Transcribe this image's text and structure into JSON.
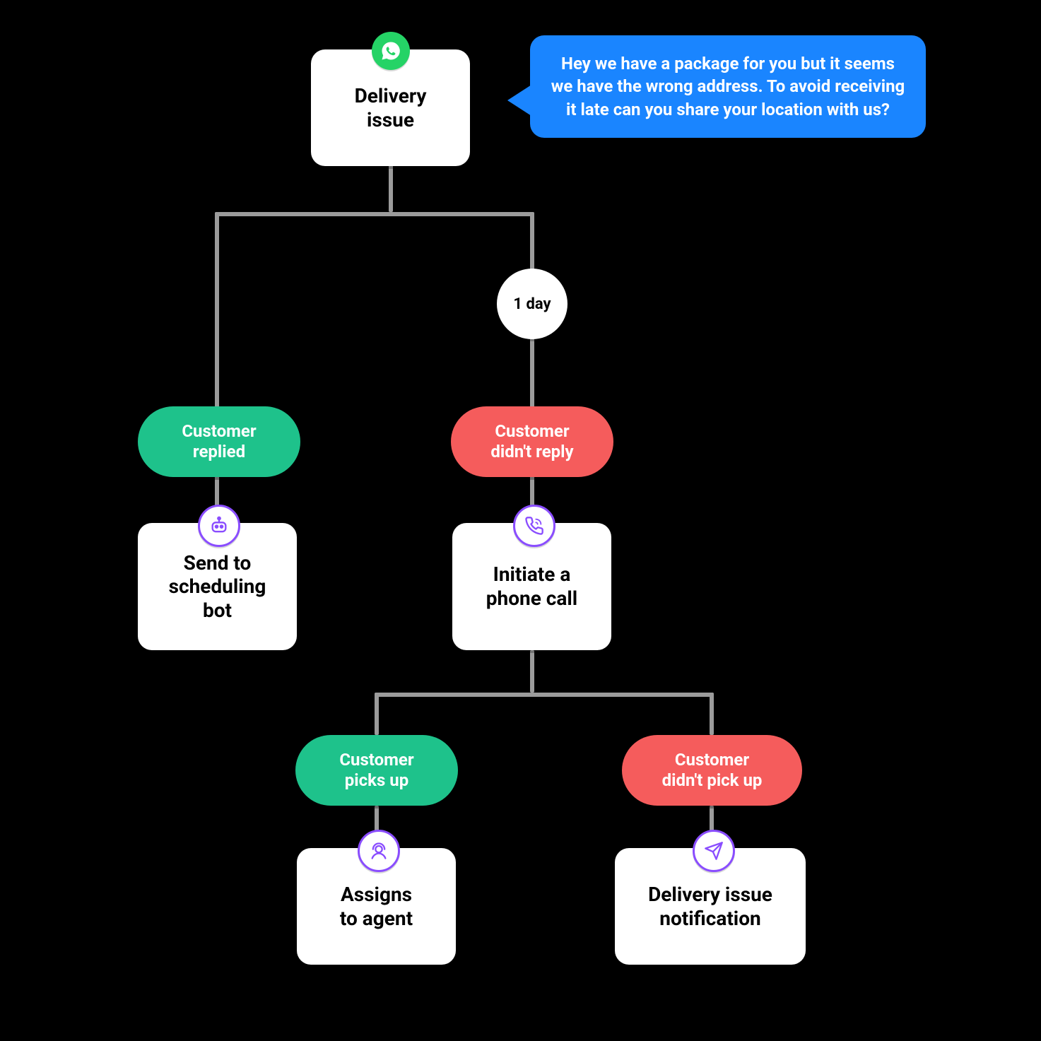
{
  "root_card": {
    "label": "Delivery\nissue"
  },
  "root_icon": "whatsapp-icon",
  "bubble_text": "Hey we have a package for you but it seems we have the wrong address. To avoid receiving it late can you share your location with us?",
  "wait_circle": "1 day",
  "decisions": {
    "replied": {
      "label": "Customer\nreplied",
      "color": "green"
    },
    "no_reply": {
      "label": "Customer\ndidn't reply",
      "color": "red"
    },
    "picks_up": {
      "label": "Customer\npicks up",
      "color": "green"
    },
    "no_pickup": {
      "label": "Customer\ndidn't pick up",
      "color": "red"
    }
  },
  "actions": {
    "scheduling_bot": {
      "label": "Send to\nscheduling\nbot",
      "icon": "bot-icon"
    },
    "phone_call": {
      "label": "Initiate a\nphone call",
      "icon": "phone-icon"
    },
    "assign_agent": {
      "label": "Assigns\nto agent",
      "icon": "agent-icon"
    },
    "notify": {
      "label": "Delivery issue\nnotification",
      "icon": "send-icon"
    }
  },
  "colors": {
    "green": "#1EC28B",
    "red": "#F55C5C",
    "blue": "#1A85FF",
    "purple": "#8A4DFF",
    "whatsapp": "#25D366",
    "line": "#9b9b9b"
  }
}
